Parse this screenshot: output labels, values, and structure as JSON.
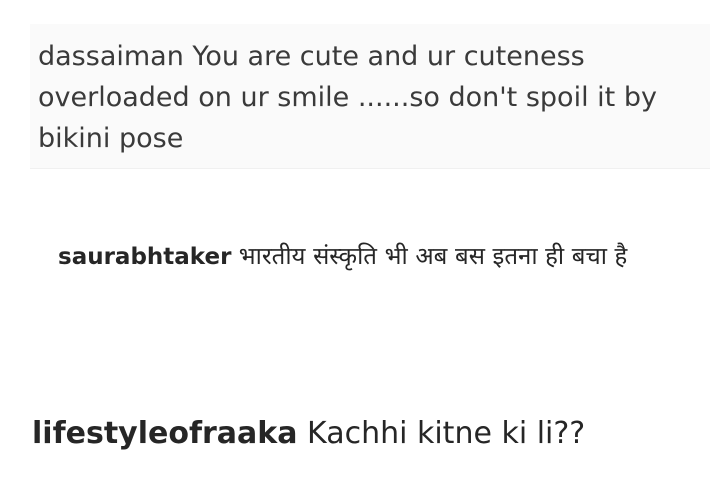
{
  "comments": [
    {
      "username": "dassaiman",
      "text": "You are cute and ur cuteness overloaded on ur smile ......so don't spoil it by bikini pose"
    },
    {
      "username": "saurabhtaker",
      "text": "भारतीय संस्कृति भी अब बस इतना ही बचा है"
    },
    {
      "username": "lifestyleofraaka",
      "text": "Kachhi kitne ki li??"
    }
  ]
}
